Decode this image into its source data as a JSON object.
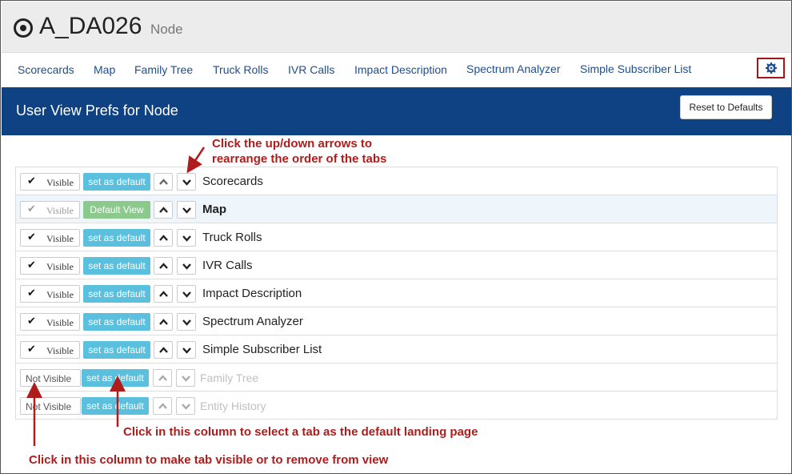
{
  "title": {
    "node_name": "A_DA026",
    "node_type": "Node"
  },
  "tabs": [
    {
      "label": "Scorecards"
    },
    {
      "label": "Map"
    },
    {
      "label": "Family Tree"
    },
    {
      "label": "Truck Rolls"
    },
    {
      "label": "IVR Calls"
    },
    {
      "label": "Impact Description"
    },
    {
      "label": "Spectrum Analyzer"
    },
    {
      "label": "Simple Subscriber List"
    }
  ],
  "header": {
    "title": "User View Prefs for Node",
    "reset_label": "Reset to Defaults"
  },
  "rows": [
    {
      "visibility": "Visible",
      "default": "set as default",
      "label": "Scorecards"
    },
    {
      "visibility": "Visible",
      "default": "Default View",
      "label": "Map"
    },
    {
      "visibility": "Visible",
      "default": "set as default",
      "label": "Truck Rolls"
    },
    {
      "visibility": "Visible",
      "default": "set as default",
      "label": "IVR Calls"
    },
    {
      "visibility": "Visible",
      "default": "set as default",
      "label": "Impact Description"
    },
    {
      "visibility": "Visible",
      "default": "set as default",
      "label": "Spectrum Analyzer"
    },
    {
      "visibility": "Visible",
      "default": "set as default",
      "label": "Simple Subscriber List"
    },
    {
      "visibility": "Not Visible",
      "default": "set as default",
      "label": "Family Tree"
    },
    {
      "visibility": "Not Visible",
      "default": "set as default",
      "label": "Entity History"
    }
  ],
  "annotations": {
    "arrows_line1": "Click the up/down arrows to",
    "arrows_line2": "rearrange the order of the tabs",
    "default_col": "Click in this column to select a tab as the default landing page",
    "visible_col": "Click in this column to make tab visible or to remove from view"
  },
  "colors": {
    "header_bg": "#0e4283",
    "set_default_btn": "#5bc0de",
    "default_view_btn": "#8bc98d",
    "annotation_red": "#b01c1c",
    "tab_link": "#1f4e8c"
  },
  "icons": {
    "title_icon": "target-icon",
    "settings": "gear-icon",
    "check": "check-icon",
    "up": "chevron-up-icon",
    "down": "chevron-down-icon"
  }
}
